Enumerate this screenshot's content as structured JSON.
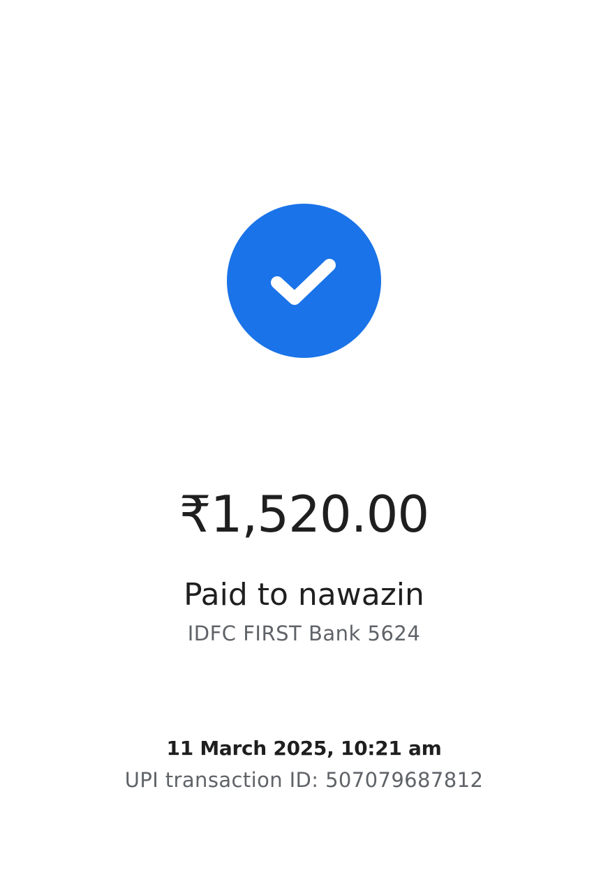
{
  "status": {
    "icon": "check-circle-icon",
    "accent_color": "#1a73e8"
  },
  "payment": {
    "amount": "₹1,520.00",
    "payee_line": "Paid to nawazin",
    "bank_line": "IDFC FIRST Bank 5624"
  },
  "transaction": {
    "datetime": "11 March 2025, 10:21 am",
    "upi_id_line": "UPI transaction ID: 507079687812"
  }
}
